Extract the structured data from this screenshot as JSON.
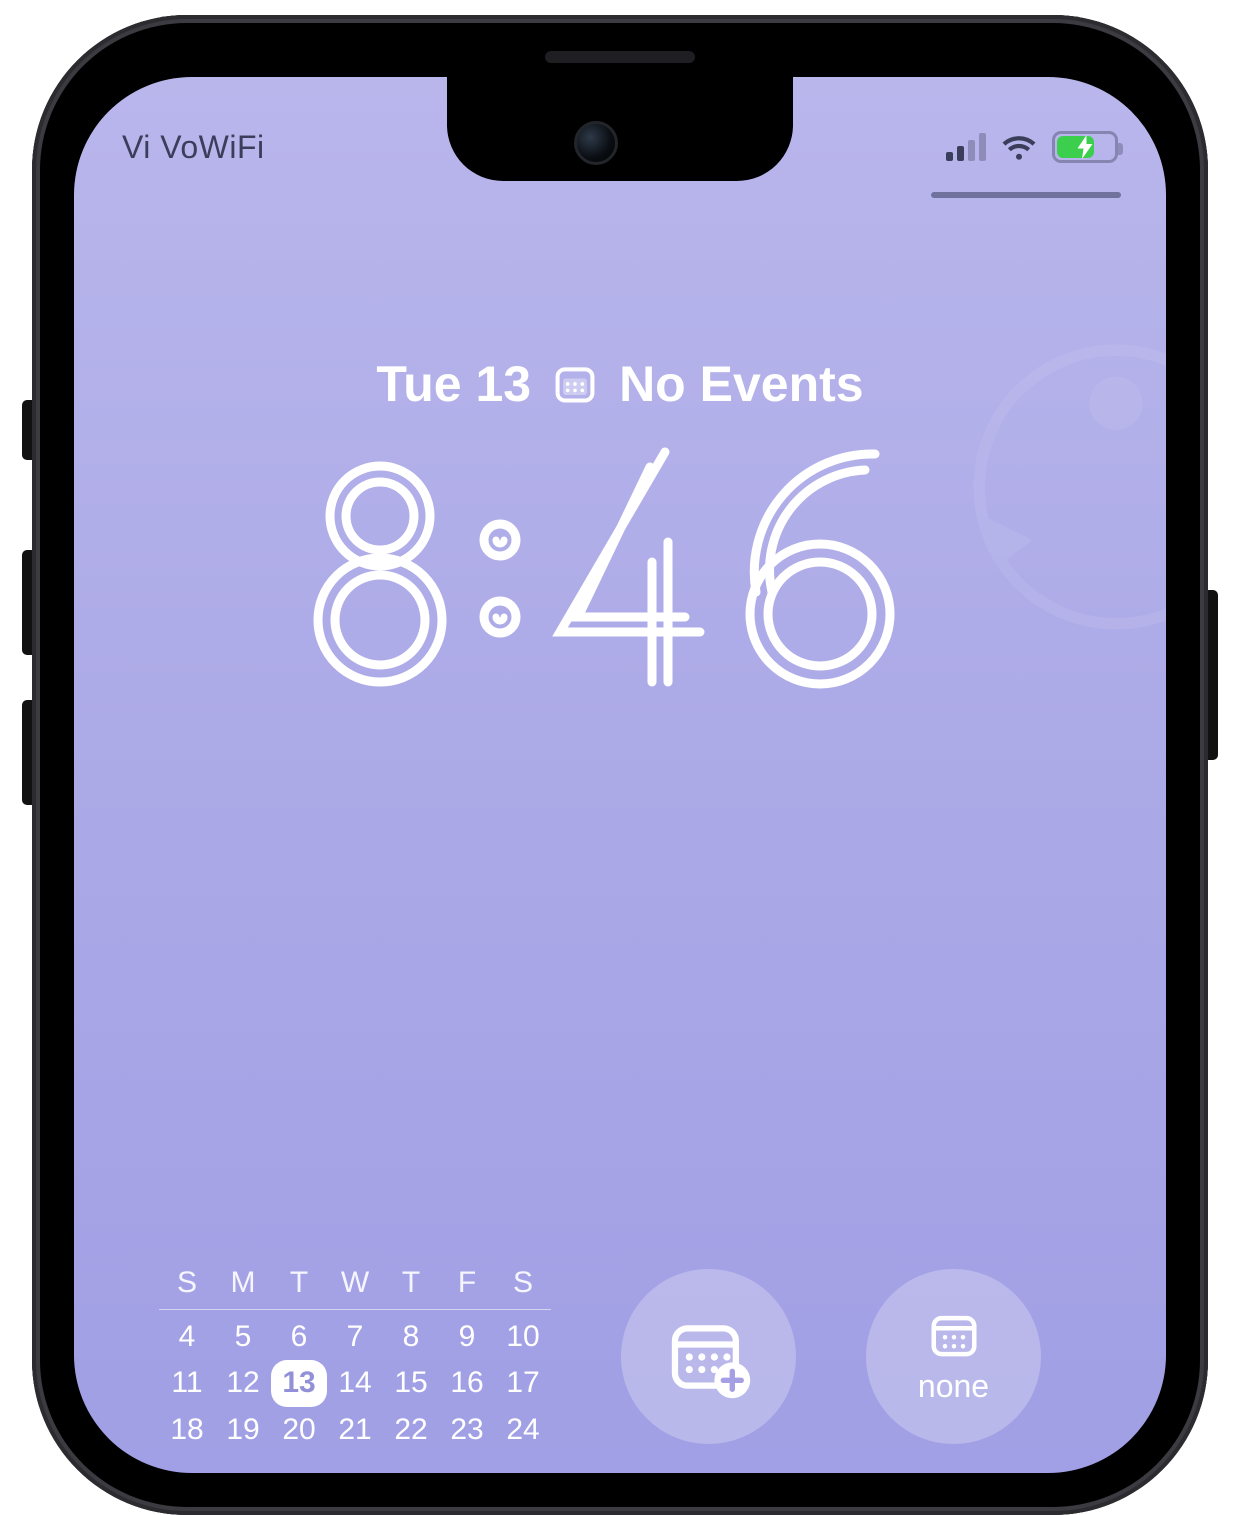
{
  "status_bar": {
    "carrier": "Vi VoWiFi",
    "signal_bars": 2,
    "battery_pct": 62,
    "battery_charging": true,
    "battery_color": "#3ccf4e",
    "wifi": true
  },
  "lockscreen": {
    "date": "Tue 13",
    "events": "No Events",
    "time": "8:46"
  },
  "mini_calendar": {
    "days": [
      "S",
      "M",
      "T",
      "W",
      "T",
      "F",
      "S"
    ],
    "rows": [
      [
        "4",
        "5",
        "6",
        "7",
        "8",
        "9",
        "10"
      ],
      [
        "11",
        "12",
        "13",
        "14",
        "15",
        "16",
        "17"
      ],
      [
        "18",
        "19",
        "20",
        "21",
        "22",
        "23",
        "24"
      ]
    ],
    "today": "13"
  },
  "widgets": {
    "add_event_label": "",
    "next_event_label": "none"
  },
  "colors": {
    "bg_top": "#b9b6ec",
    "bg_bottom": "#a19fe5",
    "status_text": "#3b3e5b"
  }
}
